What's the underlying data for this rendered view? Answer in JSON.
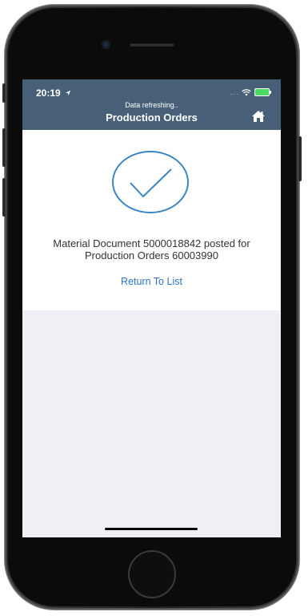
{
  "status_bar": {
    "time": "20:19",
    "signal_dots": "....",
    "location_icon": "location-arrow-icon",
    "wifi_icon": "wifi-icon",
    "battery_icon": "battery-charging-icon"
  },
  "nav": {
    "refresh_text": "Data refreshing..",
    "title": "Production Orders",
    "home_icon": "home-icon"
  },
  "confirmation": {
    "icon": "checkmark-circle-icon",
    "line1": "Material Document 5000018842 posted for",
    "line2": "Production Orders 60003990",
    "return_label": "Return To List"
  },
  "colors": {
    "nav_bar": "#476077",
    "accent": "#2f74c0",
    "check": "#3a85c4",
    "background": "#efeff4"
  }
}
